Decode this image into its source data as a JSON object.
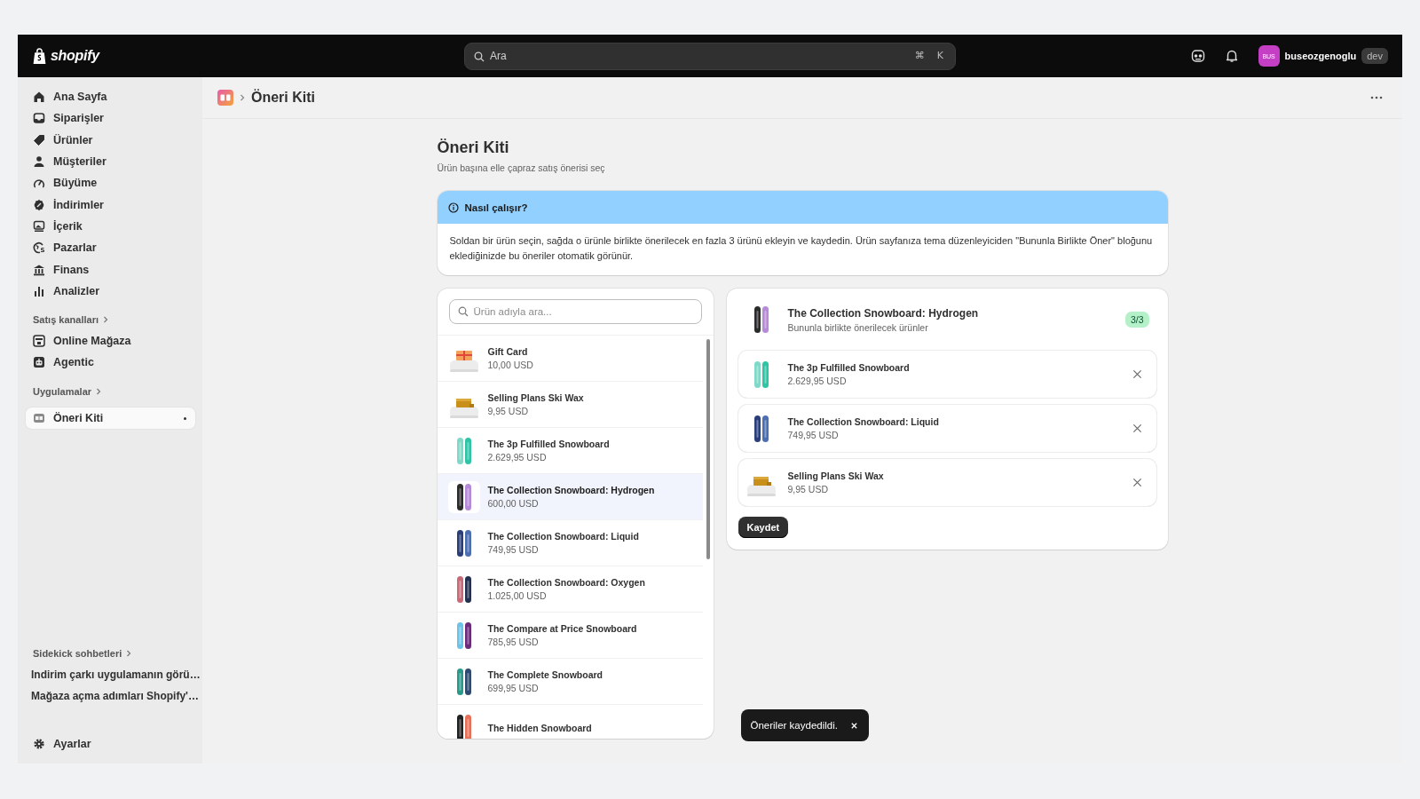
{
  "topbar": {
    "logo": "shopify",
    "search": {
      "placeholder": "Ara",
      "shortcut": [
        "⌘",
        "K"
      ]
    },
    "avatar": "BUS",
    "user": "buseozgenoglu",
    "badge": "dev"
  },
  "sidebar": {
    "items": [
      {
        "label": "Ana Sayfa",
        "selected": false
      },
      {
        "label": "Siparişler",
        "selected": false
      },
      {
        "label": "Ürünler",
        "selected": false
      },
      {
        "label": "Müşteriler",
        "selected": false
      },
      {
        "label": "Büyüme",
        "selected": false
      },
      {
        "label": "İndirimler",
        "selected": false
      },
      {
        "label": "İçerik",
        "selected": false
      },
      {
        "label": "Pazarlar",
        "selected": false
      },
      {
        "label": "Finans",
        "selected": false
      },
      {
        "label": "Analizler",
        "selected": false
      }
    ],
    "sections": [
      {
        "title": "Satış kanalları",
        "items": [
          {
            "label": "Online Mağaza",
            "selected": false
          },
          {
            "label": "Agentic",
            "selected": false
          }
        ]
      },
      {
        "title": "Uygulamalar",
        "items": [
          {
            "label": "Öneri Kiti",
            "selected": true
          }
        ]
      }
    ],
    "chats": {
      "title": "Sidekick sohbetleri",
      "items": [
        "Indirim çarkı uygulamanın görü…",
        "Mağaza açma adımları Shopify'…"
      ]
    },
    "settings": "Ayarlar"
  },
  "breadcrumb": {
    "current": "Öneri Kiti"
  },
  "page": {
    "title": "Öneri Kiti",
    "subtitle": "Ürün başına elle çapraz satış önerisi seç"
  },
  "info": {
    "title": "Nasıl çalışır?",
    "body": "Soldan bir ürün seçin, sağda o ürünle birlikte önerilecek en fazla 3 ürünü ekleyin ve kaydedin. Ürün sayfanıza tema düzenleyiciden \"Bununla Birlikte Öner\" bloğunu eklediğinizde bu öneriler otomatik görünür."
  },
  "products": {
    "search": {
      "placeholder": "Ürün adıyla ara..."
    },
    "items": [
      {
        "name": "Gift Card",
        "price": "10,00 USD",
        "selected": false
      },
      {
        "name": "Selling Plans Ski Wax",
        "price": "9,95 USD",
        "selected": false
      },
      {
        "name": "The 3p Fulfilled Snowboard",
        "price": "2.629,95 USD",
        "selected": false
      },
      {
        "name": "The Collection Snowboard: Hydrogen",
        "price": "600,00 USD",
        "selected": true
      },
      {
        "name": "The Collection Snowboard: Liquid",
        "price": "749,95 USD",
        "selected": false
      },
      {
        "name": "The Collection Snowboard: Oxygen",
        "price": "1.025,00 USD",
        "selected": false
      },
      {
        "name": "The Compare at Price Snowboard",
        "price": "785,95 USD",
        "selected": false
      },
      {
        "name": "The Complete Snowboard",
        "price": "699,95 USD",
        "selected": false
      },
      {
        "name": "The Hidden Snowboard",
        "selected": false
      }
    ]
  },
  "suggestions": {
    "title": "The Collection Snowboard: Hydrogen",
    "subtitle": "Bununla birlikte önerilecek ürünler",
    "count": "3/3",
    "items": [
      {
        "name": "The 3p Fulfilled Snowboard",
        "price": "2.629,95 USD"
      },
      {
        "name": "The Collection Snowboard: Liquid",
        "price": "749,95 USD"
      },
      {
        "name": "Selling Plans Ski Wax",
        "price": "9,95 USD"
      }
    ],
    "save": "Kaydet"
  },
  "toast": {
    "text": "Öneriler kaydedildi."
  }
}
